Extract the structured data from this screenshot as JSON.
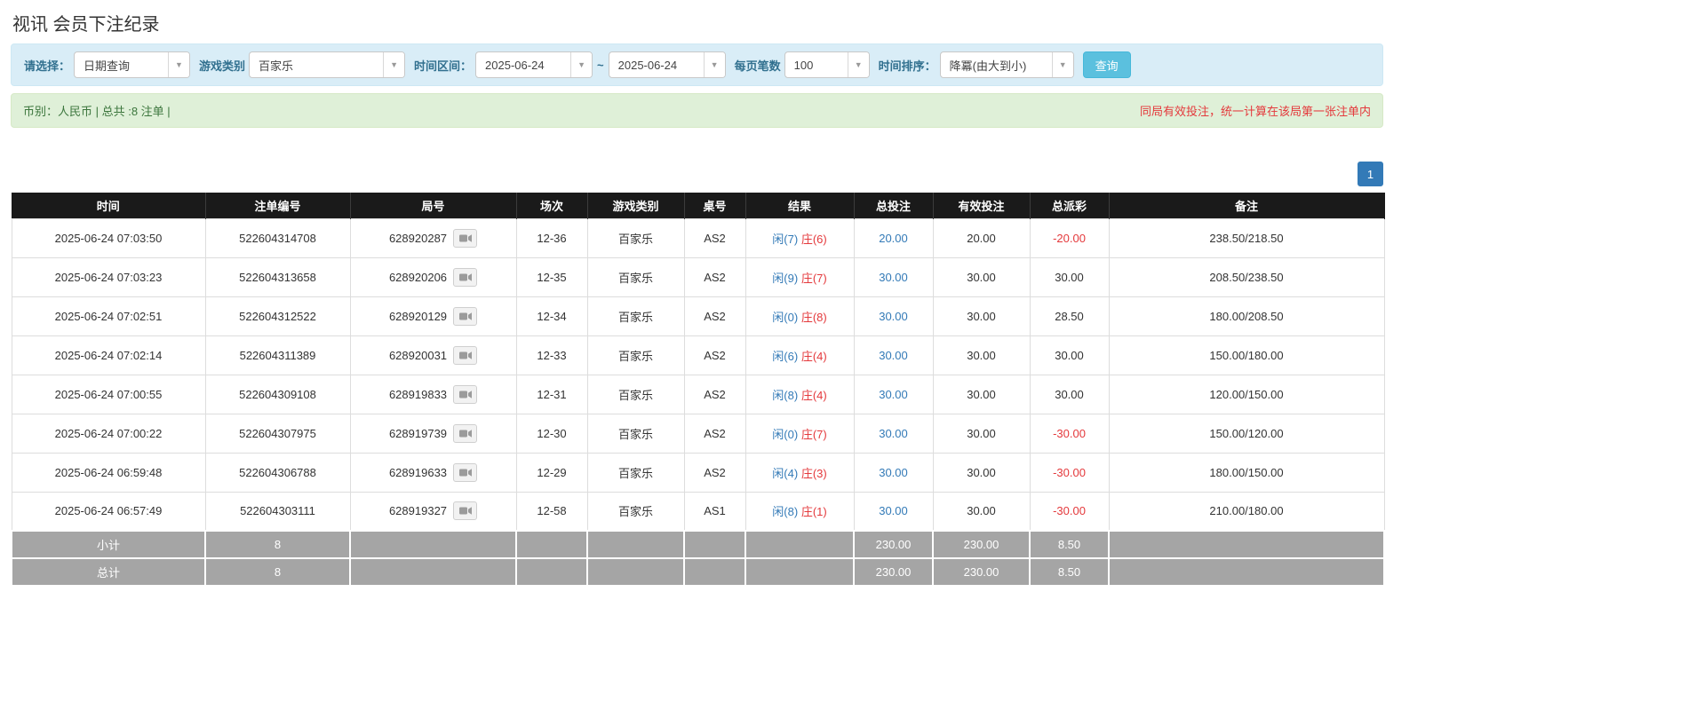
{
  "page": {
    "title": "视讯 会员下注纪录"
  },
  "colors": {
    "accent_blue": "#337ab7",
    "negative_red": "#e4393c",
    "info_green": "#3c763d",
    "filter_bg": "#d9edf7",
    "header_bg": "#1a1a1a",
    "footer_bg": "#a5a5a5"
  },
  "filters": {
    "select_label": "请选择：",
    "select_value": "日期查询",
    "game_type_label": "游戏类别",
    "game_type_value": "百家乐",
    "time_range_label": "时间区间：",
    "date_from": "2025-06-24",
    "tilde": "~",
    "date_to": "2025-06-24",
    "page_size_label": "每页笔数",
    "page_size_value": "100",
    "sort_label": "时间排序：",
    "sort_value": "降冪(由大到小)",
    "query_button": "查询"
  },
  "info_bar": {
    "left": "币别：人民币 | 总共 :8 注单 |",
    "right": "同局有效投注，统一计算在该局第一张注单内"
  },
  "pagination": {
    "current": "1"
  },
  "table": {
    "headers": [
      "时间",
      "注单编号",
      "局号",
      "场次",
      "游戏类别",
      "桌号",
      "结果",
      "总投注",
      "有效投注",
      "总派彩",
      "备注"
    ],
    "rows": [
      {
        "time": "2025-06-24 07:03:50",
        "bet_no": "522604314708",
        "round_no": "628920287",
        "session": "12-36",
        "game": "百家乐",
        "table": "AS2",
        "result_player": "闲(7)",
        "result_banker": "庄(6)",
        "total_bet": "20.00",
        "valid_bet": "20.00",
        "payout": "-20.00",
        "note": "238.50/218.50"
      },
      {
        "time": "2025-06-24 07:03:23",
        "bet_no": "522604313658",
        "round_no": "628920206",
        "session": "12-35",
        "game": "百家乐",
        "table": "AS2",
        "result_player": "闲(9)",
        "result_banker": "庄(7)",
        "total_bet": "30.00",
        "valid_bet": "30.00",
        "payout": "30.00",
        "note": "208.50/238.50"
      },
      {
        "time": "2025-06-24 07:02:51",
        "bet_no": "522604312522",
        "round_no": "628920129",
        "session": "12-34",
        "game": "百家乐",
        "table": "AS2",
        "result_player": "闲(0)",
        "result_banker": "庄(8)",
        "total_bet": "30.00",
        "valid_bet": "30.00",
        "payout": "28.50",
        "note": "180.00/208.50"
      },
      {
        "time": "2025-06-24 07:02:14",
        "bet_no": "522604311389",
        "round_no": "628920031",
        "session": "12-33",
        "game": "百家乐",
        "table": "AS2",
        "result_player": "闲(6)",
        "result_banker": "庄(4)",
        "total_bet": "30.00",
        "valid_bet": "30.00",
        "payout": "30.00",
        "note": "150.00/180.00"
      },
      {
        "time": "2025-06-24 07:00:55",
        "bet_no": "522604309108",
        "round_no": "628919833",
        "session": "12-31",
        "game": "百家乐",
        "table": "AS2",
        "result_player": "闲(8)",
        "result_banker": "庄(4)",
        "total_bet": "30.00",
        "valid_bet": "30.00",
        "payout": "30.00",
        "note": "120.00/150.00"
      },
      {
        "time": "2025-06-24 07:00:22",
        "bet_no": "522604307975",
        "round_no": "628919739",
        "session": "12-30",
        "game": "百家乐",
        "table": "AS2",
        "result_player": "闲(0)",
        "result_banker": "庄(7)",
        "total_bet": "30.00",
        "valid_bet": "30.00",
        "payout": "-30.00",
        "note": "150.00/120.00"
      },
      {
        "time": "2025-06-24 06:59:48",
        "bet_no": "522604306788",
        "round_no": "628919633",
        "session": "12-29",
        "game": "百家乐",
        "table": "AS2",
        "result_player": "闲(4)",
        "result_banker": "庄(3)",
        "total_bet": "30.00",
        "valid_bet": "30.00",
        "payout": "-30.00",
        "note": "180.00/150.00"
      },
      {
        "time": "2025-06-24 06:57:49",
        "bet_no": "522604303111",
        "round_no": "628919327",
        "session": "12-58",
        "game": "百家乐",
        "table": "AS1",
        "result_player": "闲(8)",
        "result_banker": "庄(1)",
        "total_bet": "30.00",
        "valid_bet": "30.00",
        "payout": "-30.00",
        "note": "210.00/180.00"
      }
    ],
    "subtotal": {
      "label": "小计",
      "count": "8",
      "total_bet": "230.00",
      "valid_bet": "230.00",
      "payout": "8.50"
    },
    "total": {
      "label": "总计",
      "count": "8",
      "total_bet": "230.00",
      "valid_bet": "230.00",
      "payout": "8.50"
    }
  }
}
